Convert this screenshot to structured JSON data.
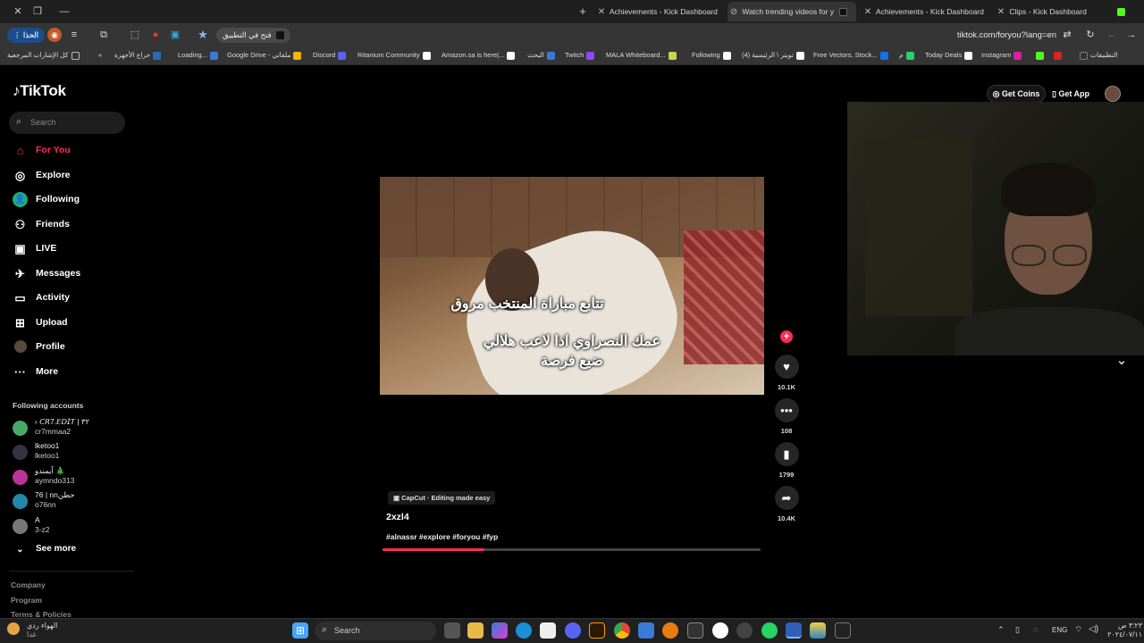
{
  "browser": {
    "tabs": [
      {
        "title": "Achievements - Kick Dashboard",
        "active": false
      },
      {
        "title": "Watch trending videos for y",
        "active": true
      },
      {
        "title": "Achievements - Kick Dashboard",
        "active": false
      },
      {
        "title": "Clips - Kick Dashboard",
        "active": false
      }
    ],
    "new_tab": "+",
    "address": "tiktok.com/foryou?lang=en",
    "open_in_app": "فتح في التطبيق",
    "profile_button": "الحذا",
    "bookmarks": [
      {
        "label": "التطبيقات",
        "color": "#888"
      },
      {
        "label": "",
        "color": "#d22"
      },
      {
        "label": "",
        "color": "#53fc18"
      },
      {
        "label": "Instagram",
        "color": "#d6249f"
      },
      {
        "label": "Today Deals",
        "color": "#fff"
      },
      {
        "label": "م",
        "color": "#25d366"
      },
      {
        "label": "Free Vectors, Stock...",
        "color": "#1273eb"
      },
      {
        "label": "(4) تويتر \\ الرئيسية",
        "color": "#fff"
      },
      {
        "label": "Following",
        "color": "#fff"
      },
      {
        "label": "MALA Whiteboard...",
        "color": "#c9d84a"
      },
      {
        "label": "Twitch",
        "color": "#9146ff"
      },
      {
        "label": "البحث",
        "color": "#3a7bd5"
      },
      {
        "label": "Amazon.sa is here|...",
        "color": "#fff"
      },
      {
        "label": "Ritanium Community",
        "color": "#fff"
      },
      {
        "label": "Discord",
        "color": "#5865f2"
      },
      {
        "label": "Google Drive - ملفاتي",
        "color": "#f4b400"
      },
      {
        "label": "Loading...",
        "color": "#3a7bd5"
      },
      {
        "label": "حراج الأجهزة",
        "color": "#2b6cb0"
      },
      {
        "label": "كل الإشارات المرجعية",
        "color": "#888"
      }
    ]
  },
  "tiktok": {
    "logo": "TikTok",
    "search_placeholder": "Search",
    "get_coins": "Get Coins",
    "get_app": "Get App",
    "nav": [
      {
        "label": "For You",
        "icon": "home-icon",
        "active": true
      },
      {
        "label": "Explore",
        "icon": "compass-icon",
        "active": false
      },
      {
        "label": "Following",
        "icon": "following-icon",
        "active": false
      },
      {
        "label": "Friends",
        "icon": "friends-icon",
        "active": false
      },
      {
        "label": "LIVE",
        "icon": "live-icon",
        "active": false
      },
      {
        "label": "Messages",
        "icon": "messages-icon",
        "active": false
      },
      {
        "label": "Activity",
        "icon": "activity-icon",
        "active": false
      },
      {
        "label": "Upload",
        "icon": "upload-icon",
        "active": false
      },
      {
        "label": "Profile",
        "icon": "profile-icon",
        "active": false
      },
      {
        "label": "More",
        "icon": "more-icon",
        "active": false
      }
    ],
    "following_title": "Following accounts",
    "accounts": [
      {
        "name": "‹ 𝘊𝘙7.𝘌𝘋𝘐𝘛 | ٣٢",
        "handle": "cr7mmaa2"
      },
      {
        "name": "lketoo1",
        "handle": "lketoo1"
      },
      {
        "name": "آيمندو 🎄",
        "handle": "aymndo313"
      },
      {
        "name": "76 | nnحطن",
        "handle": "o76nn"
      },
      {
        "name": "A",
        "handle": "3-z2"
      }
    ],
    "see_more": "See more",
    "footer": [
      "Company",
      "Program",
      "Terms & Policies"
    ]
  },
  "video": {
    "caption_line1": "تتابع مباراة المنتخب مروق",
    "caption_line2": "عمك النصراوي اذا لاعب هلالي",
    "caption_line3": "ضيع فرصة",
    "capcut_label": "CapCut · Editing made easy",
    "author": "2xzl4",
    "hashtags": "#alnassr #explore #foryou #fyp",
    "progress": 0.27,
    "likes": "10.1K",
    "comments": "108",
    "saves": "1799",
    "shares": "10.4K"
  },
  "taskbar": {
    "weather_label": "الهواء ردي",
    "weather_sub": "غدا",
    "search": "Search",
    "lang": "ENG",
    "time": "٣:٢٣ ص",
    "date": "٢٠٢٤/٠٧/١١"
  }
}
